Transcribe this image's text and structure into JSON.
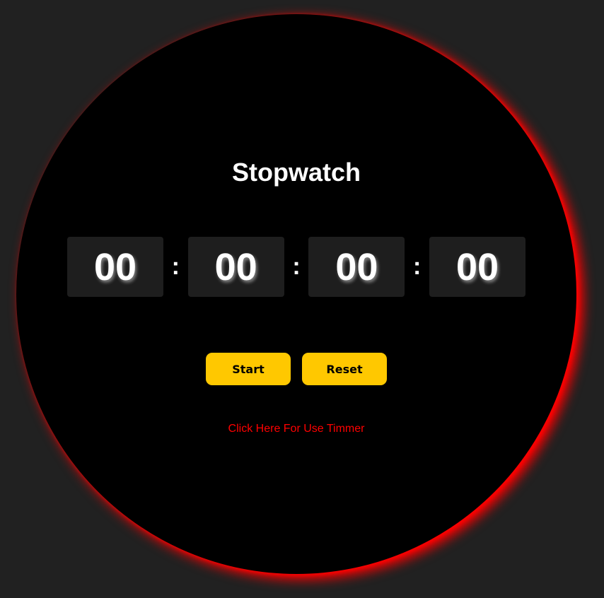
{
  "stopwatch": {
    "title": "Stopwatch",
    "hours": "00",
    "minutes": "00",
    "seconds": "00",
    "centiseconds": "00",
    "separator": ":"
  },
  "controls": {
    "start_label": "Start",
    "reset_label": "Reset"
  },
  "timer_link": {
    "label": "Click Here For Use Timmer"
  },
  "colors": {
    "page_background": "#212121",
    "dial_background": "#000000",
    "glow": "#ff0000",
    "digit_box": "#1e1e1e",
    "button": "#ffc800",
    "link": "#ff0000"
  }
}
